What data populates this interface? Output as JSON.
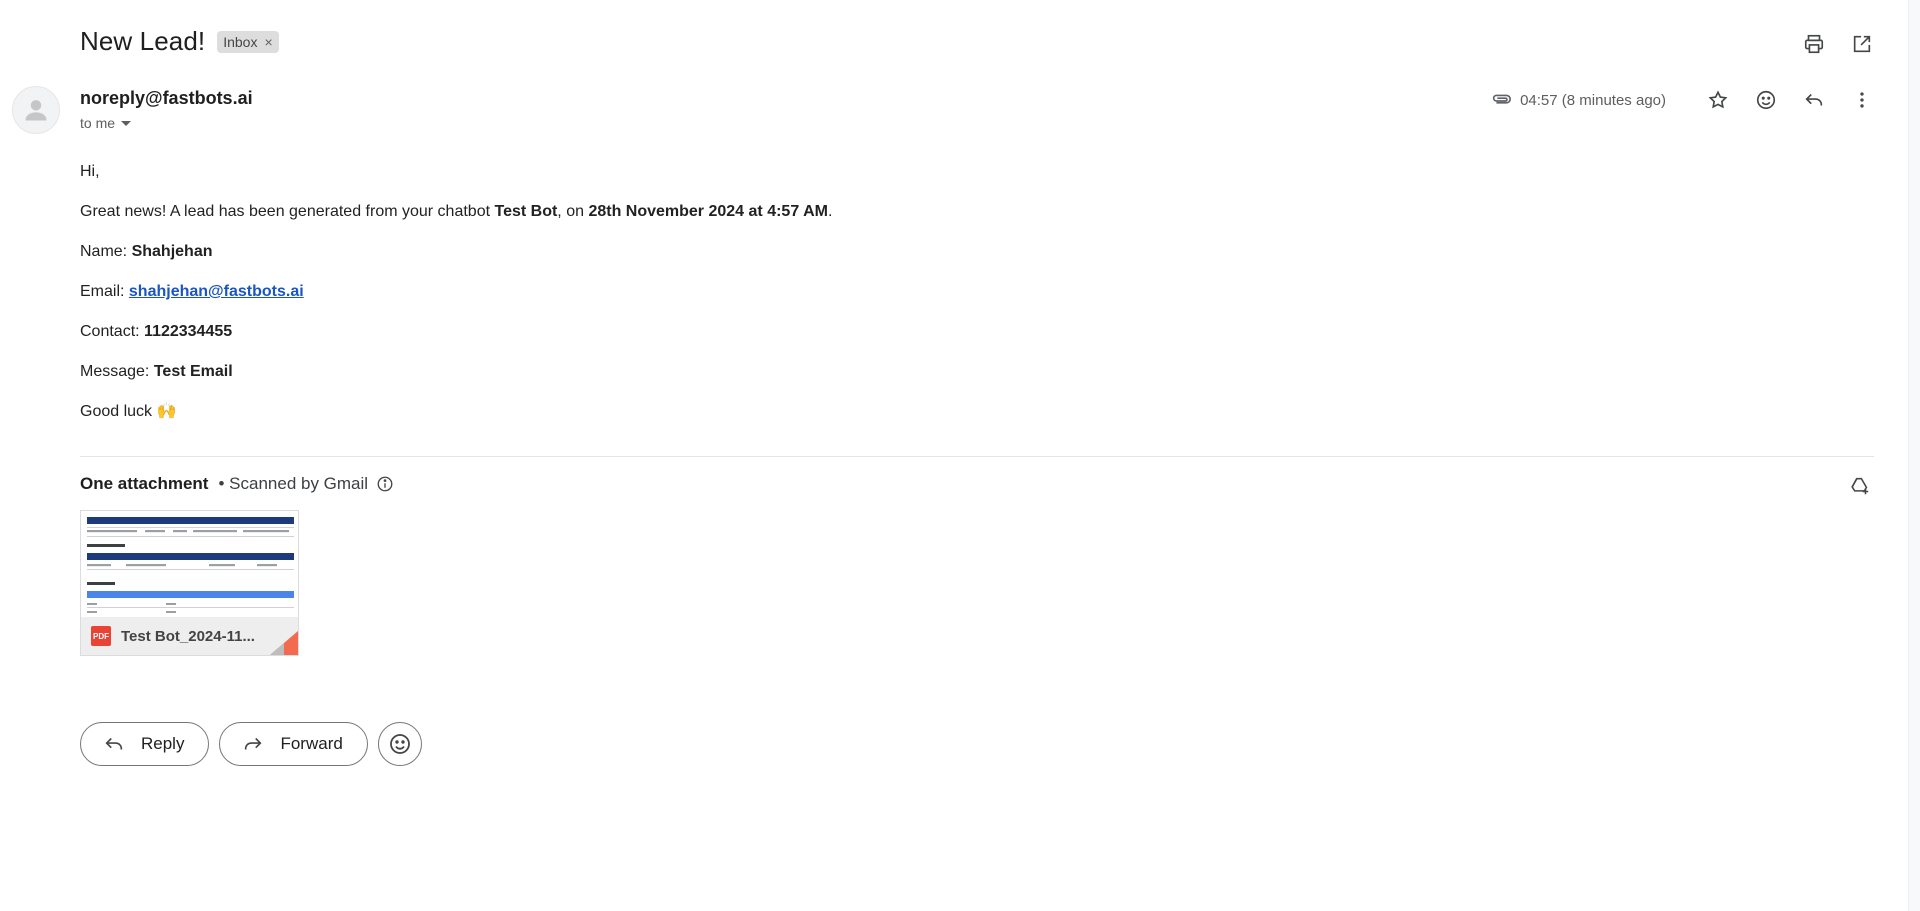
{
  "header": {
    "subject": "New Lead!",
    "label": "Inbox",
    "label_remove": "×"
  },
  "sender": {
    "email": "noreply@fastbots.ai",
    "recipient": "to me",
    "time": "04:57 (8 minutes ago)"
  },
  "body": {
    "greeting": "Hi,",
    "intro_before": "Great news! A lead has been generated from your chatbot ",
    "bot_name": "Test Bot",
    "intro_mid": ", on ",
    "date_time": "28th November 2024 at 4:57 AM",
    "intro_end": ".",
    "name_label": "Name:",
    "name_value": "Shahjehan",
    "email_label": "Email:",
    "email_value": "shahjehan@fastbots.ai",
    "contact_label": "Contact:",
    "contact_value": "1122334455",
    "message_label": "Message:",
    "message_value": "Test Email",
    "closing": "Good luck 🙌"
  },
  "attachments": {
    "count_label": "One attachment",
    "scan_label": "• Scanned by Gmail",
    "file_name": "Test Bot_2024-11...",
    "file_type": "PDF"
  },
  "actions": {
    "reply": "Reply",
    "forward": "Forward"
  },
  "icons": {
    "print": "print-icon",
    "open_new_window": "open-in-new-window-icon",
    "attachment": "paperclip-icon",
    "star": "star-icon",
    "emoji": "emoji-icon",
    "reply": "reply-icon",
    "more": "more-vertical-icon",
    "info": "info-icon",
    "drive_add": "add-to-drive-icon"
  },
  "colors": {
    "link": "#1a55c7",
    "pdf": "#ea4335",
    "label_chip": "#dddddd"
  }
}
